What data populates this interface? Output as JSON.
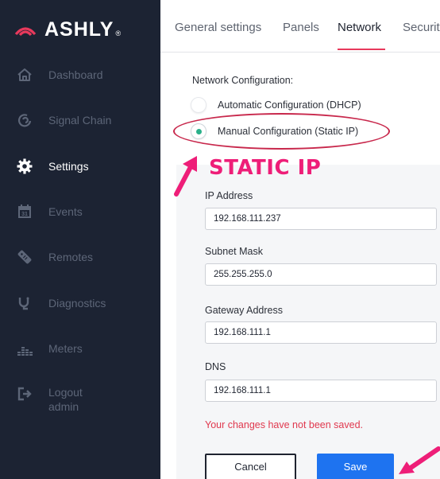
{
  "sidebar": {
    "brand": "ASHLY",
    "brand_mark": "®",
    "items": [
      {
        "label": "Dashboard",
        "icon": "home-icon"
      },
      {
        "label": "Signal Chain",
        "icon": "signal-chain-icon"
      },
      {
        "label": "Settings",
        "icon": "gear-icon",
        "active": true
      },
      {
        "label": "Events",
        "icon": "calendar-icon",
        "icon_text": "31"
      },
      {
        "label": "Remotes",
        "icon": "remote-icon"
      },
      {
        "label": "Diagnostics",
        "icon": "stethoscope-icon"
      },
      {
        "label": "Meters",
        "icon": "meters-icon"
      },
      {
        "label": "Logout",
        "sub": "admin",
        "icon": "logout-icon"
      }
    ]
  },
  "tabs": [
    {
      "label": "General settings"
    },
    {
      "label": "Panels"
    },
    {
      "label": "Network",
      "active": true
    },
    {
      "label": "Securit"
    }
  ],
  "network": {
    "section_label": "Network Configuration:",
    "options": [
      {
        "label": "Automatic Configuration (DHCP)",
        "checked": false
      },
      {
        "label": "Manual Configuration (Static IP)",
        "checked": true
      }
    ],
    "annotation": "STATIC IP",
    "fields": [
      {
        "label": "IP Address",
        "value": "192.168.111.237"
      },
      {
        "label": "Subnet Mask",
        "value": "255.255.255.0"
      },
      {
        "label": "Gateway Address",
        "value": "192.168.111.1"
      },
      {
        "label": "DNS",
        "value": "192.168.111.1"
      }
    ],
    "unsaved_warning": "Your changes have not been saved.",
    "cancel_label": "Cancel",
    "save_label": "Save"
  },
  "colors": {
    "sidebar_bg": "#1c2333",
    "accent": "#e8395c",
    "radio_checked": "#2ab08a",
    "annotation": "#ee1e78",
    "save_button": "#1e73f0",
    "warning": "#e0384e"
  }
}
